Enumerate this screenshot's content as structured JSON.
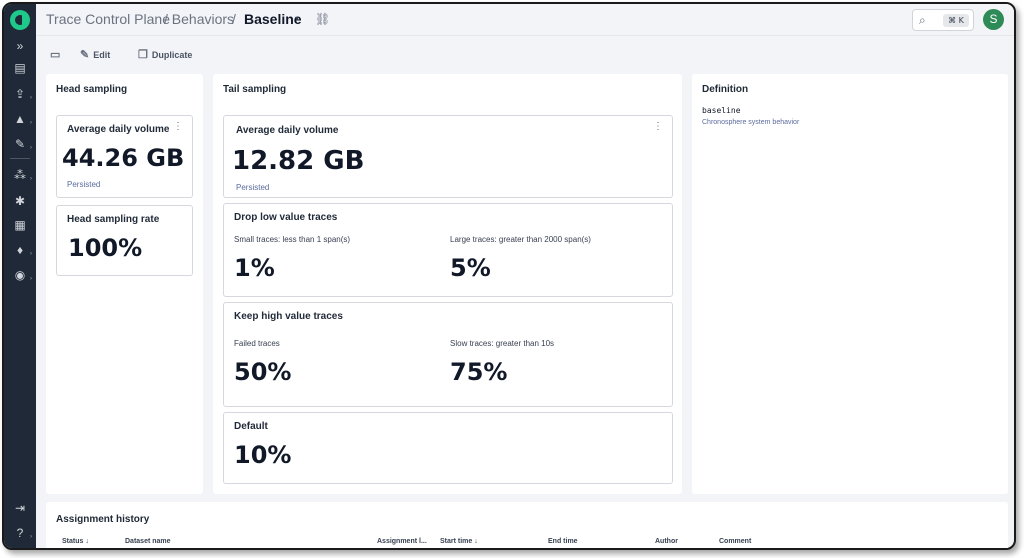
{
  "breadcrumb": {
    "root": "Trace Control Plane",
    "section": "/ Behaviors",
    "sep": "/",
    "current": "Baseline"
  },
  "search": {
    "shortcut": "⌘ K"
  },
  "user": {
    "initial": "S"
  },
  "toolbar": {
    "edit_label": "Edit",
    "duplicate_label": "Duplicate"
  },
  "head": {
    "title": "Head sampling",
    "volume": {
      "title": "Average daily volume",
      "value": "44.26 GB",
      "sub": "Persisted"
    },
    "rate": {
      "title": "Head sampling rate",
      "value": "100%"
    }
  },
  "tail": {
    "title": "Tail sampling",
    "volume": {
      "title": "Average daily volume",
      "value": "12.82 GB",
      "sub": "Persisted"
    },
    "drop": {
      "title": "Drop low value traces",
      "small_label": "Small traces: less than 1 span(s)",
      "small_value": "1%",
      "large_label": "Large traces: greater than 2000 span(s)",
      "large_value": "5%"
    },
    "keep": {
      "title": "Keep high value traces",
      "failed_label": "Failed traces",
      "failed_value": "50%",
      "slow_label": "Slow traces: greater than 10s",
      "slow_value": "75%"
    },
    "default": {
      "title": "Default",
      "value": "10%"
    }
  },
  "definition": {
    "title": "Definition",
    "slug": "baseline",
    "description": "Chronosphere system behavior"
  },
  "history": {
    "title": "Assignment history",
    "columns": [
      "Status",
      "Dataset name",
      "Assignment l...",
      "Start time",
      "End time",
      "Author",
      "Comment"
    ]
  },
  "colors": {
    "sidebar": "#1f2937",
    "brand": "#1ec98a",
    "avatar": "#2e8b57",
    "muted_link": "#5b6c9e"
  }
}
